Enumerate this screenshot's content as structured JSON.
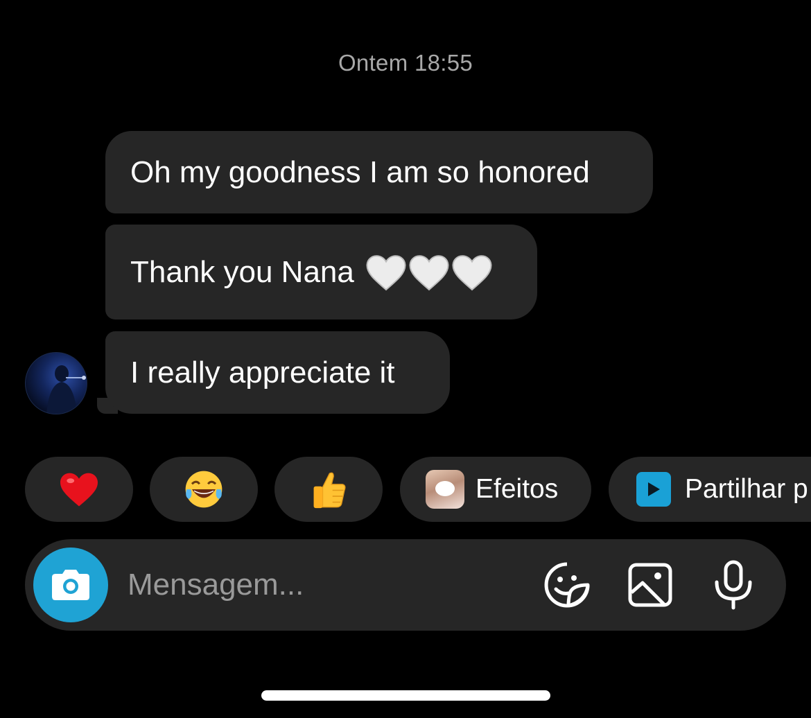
{
  "thread": {
    "timestamp": "Ontem 18:55",
    "messages": [
      {
        "text": "Oh my goodness I am so honored"
      },
      {
        "text": "Thank you Nana",
        "trailing_emoji": [
          "white-heart",
          "white-heart",
          "white-heart"
        ]
      },
      {
        "text": "I really appreciate it"
      }
    ]
  },
  "quick_actions": {
    "reactions": [
      "red-heart-emoji",
      "tears-of-joy-emoji",
      "thumbs-up-emoji"
    ],
    "effects_label": "Efeitos",
    "share_label": "Partilhar p"
  },
  "composer": {
    "placeholder": "Mensagem...",
    "icons": [
      "camera-icon",
      "sticker-icon",
      "gallery-icon",
      "microphone-icon"
    ]
  },
  "colors": {
    "background": "#000000",
    "bubble": "#262626",
    "timestamp": "#a8a8a8",
    "accent": "#1fa3d4"
  }
}
